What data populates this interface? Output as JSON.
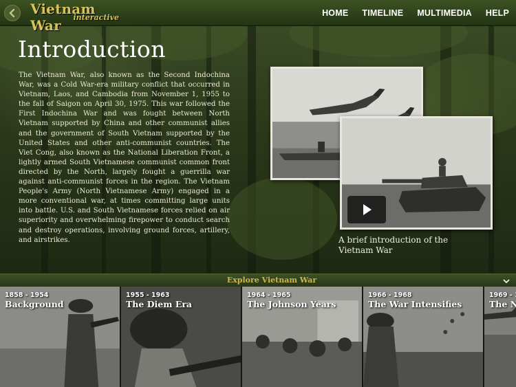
{
  "brand": {
    "title": "Vietnam War",
    "subtitle": "interactive"
  },
  "nav": [
    {
      "label": "HOME"
    },
    {
      "label": "TIMELINE"
    },
    {
      "label": "MULTIMEDIA"
    },
    {
      "label": "HELP"
    }
  ],
  "page": {
    "title": "Introduction",
    "body": "The Vietnam War, also known as the Second Indochina War, was a Cold War-era military conflict that occurred in Vietnam, Laos, and Cambodia from November 1, 1955 to the fall of Saigon on April 30, 1975. This war followed the First Indochina War and was fought between North Vietnam supported by China and other communist allies and the government of South Vietnam supported by the United States and other anti-communist countries. The Viet Cong, also known as the National Liberation Front, a lightly armed South Vietnamese communist common front directed by the North, largely fought a guerrilla war against anti-communist forces in the region. The Vietnam People's Army (North Vietnamese Army) engaged in a more conventional war, at times committing large units into battle. U.S. and South Vietnamese forces relied on air superiority and overwhelming firepower to conduct search and destroy operations, involving ground forces, artillery, and airstrikes.",
    "video_caption": "A brief introduction of the Vietnam War"
  },
  "explore": {
    "label": "Explore Vietnam War"
  },
  "eras": [
    {
      "years": "1858 - 1954",
      "title": "Background"
    },
    {
      "years": "1955 - 1963",
      "title": "The Diem Era"
    },
    {
      "years": "1964 - 1965",
      "title": "The Johnson Years"
    },
    {
      "years": "1966 - 1968",
      "title": "The War Intensifies"
    },
    {
      "years": "1969 - 1",
      "title": "The N"
    }
  ],
  "colors": {
    "accent_gold": "#d6c35a",
    "bar_green": "#3c5222",
    "text_light": "#ece9d8"
  },
  "icons": {
    "back": "circle-arrow-left-icon",
    "play": "play-icon",
    "collapse": "chevron-down-icon"
  }
}
